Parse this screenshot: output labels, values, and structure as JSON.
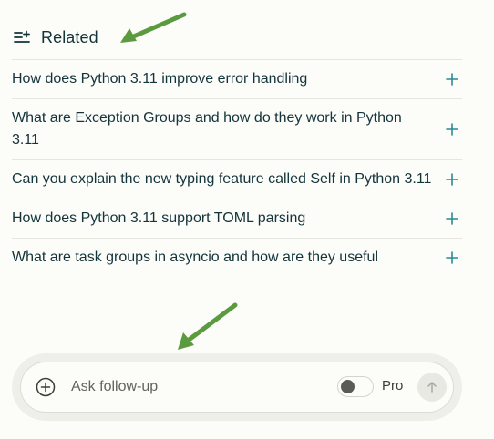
{
  "related": {
    "title": "Related",
    "icon": "list-filter-icon",
    "items": [
      {
        "label": "How does Python 3.11 improve error handling",
        "action_icon": "plus-icon"
      },
      {
        "label": "What are Exception Groups and how do they work in Python 3.11",
        "action_icon": "plus-icon"
      },
      {
        "label": "Can you explain the new typing feature called Self in Python 3.11",
        "action_icon": "plus-icon"
      },
      {
        "label": "How does Python 3.11 support TOML parsing",
        "action_icon": "plus-icon"
      },
      {
        "label": "What are task groups in asyncio and how are they useful",
        "action_icon": "plus-icon"
      }
    ]
  },
  "followup": {
    "placeholder": "Ask follow-up",
    "value": "",
    "add_icon": "circle-plus-icon",
    "pro_label": "Pro",
    "pro_enabled": false,
    "submit_icon": "arrow-up-icon"
  },
  "annotations": {
    "arrow_color": "#5b9a3e",
    "arrow_icon": "arrow-icon"
  },
  "colors": {
    "background": "#fcfcf9",
    "text": "#13343b",
    "accent": "#2a8a96",
    "divider": "#e6e6e1"
  }
}
